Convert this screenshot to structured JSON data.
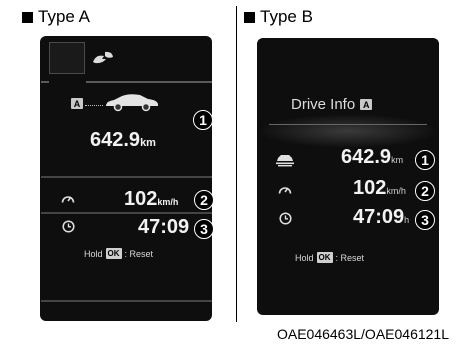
{
  "type_a": {
    "title": "Type A",
    "badge": "A",
    "distance_value": "642.9",
    "distance_unit": "km",
    "speed_value": "102",
    "speed_unit": "km/h",
    "time_value": "47:09",
    "hold_label": "Hold",
    "ok_label": "OK",
    "reset_label": ": Reset",
    "callouts": [
      "1",
      "2",
      "3"
    ]
  },
  "type_b": {
    "title": "Type B",
    "screen_title": "Drive Info",
    "badge": "A",
    "distance_value": "642.9",
    "distance_unit": "km",
    "speed_value": "102",
    "speed_unit": "km/h",
    "time_value": "47:09",
    "time_unit": "h",
    "hold_label": "Hold",
    "ok_label": "OK",
    "reset_label": ": Reset",
    "callouts": [
      "1",
      "2",
      "3"
    ]
  },
  "reference_code": "OAE046463L/OAE046121L",
  "icons": [
    "eco-leaf-icon",
    "car-icon",
    "speedometer-icon",
    "clock-icon",
    "range-car-icon"
  ],
  "colors": {
    "screen": "#0e0e0e",
    "text": "#ececec",
    "callout": "#000000"
  }
}
